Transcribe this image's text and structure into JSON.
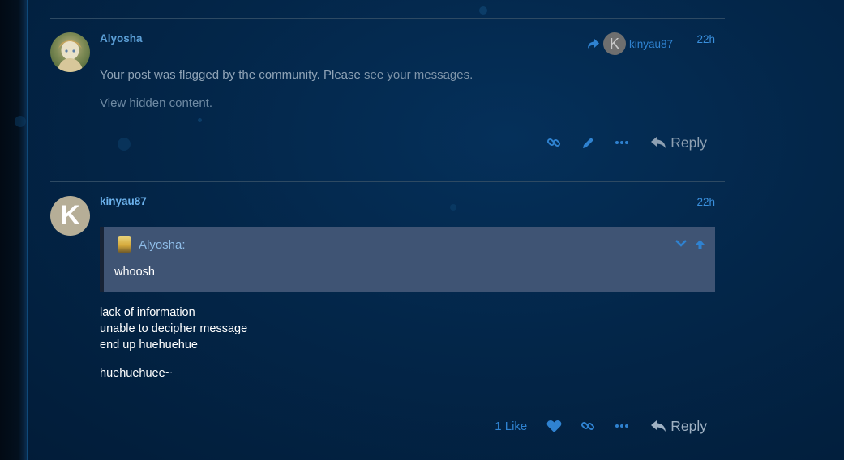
{
  "posts": [
    {
      "username": "Alyosha",
      "date": "22h",
      "reply_to": {
        "username": "kinyau87",
        "avatar_letter": "K"
      },
      "flag_message": "Your post was flagged by the community. Please",
      "flag_link": "see your messages.",
      "hidden_content": "View hidden content.",
      "actions": {
        "reply_label": "Reply"
      }
    },
    {
      "username": "kinyau87",
      "avatar_letter": "K",
      "date": "22h",
      "quote": {
        "author": "Alyosha:",
        "text": "whoosh"
      },
      "body_lines": [
        "lack of information",
        "unable to decipher message",
        "end up huehuehue"
      ],
      "body_tail": "huehuehuee~",
      "actions": {
        "like_count": "1 Like",
        "reply_label": "Reply"
      }
    }
  ],
  "colors": {
    "background": "#032649",
    "link": "#2f82d0",
    "quote_bg": "#3f5474"
  },
  "icons": [
    "link-icon",
    "pencil-icon",
    "more-icon",
    "reply-icon",
    "heart-icon",
    "chevron-down-icon",
    "arrow-up-icon",
    "share-arrow-icon"
  ]
}
